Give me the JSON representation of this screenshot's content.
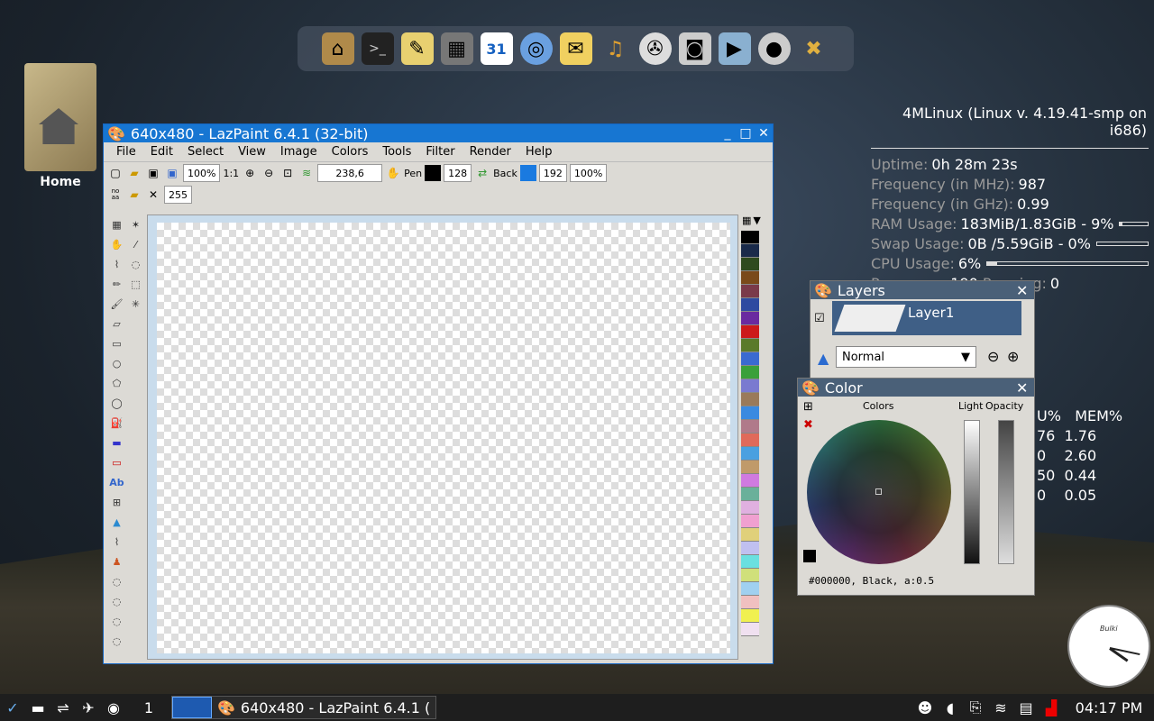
{
  "dock": {
    "icons": [
      "home-icon",
      "terminal-icon",
      "notes-icon",
      "calculator-icon",
      "calendar-icon",
      "browser-icon",
      "mail-icon",
      "headphones-icon",
      "video-reel-icon",
      "camera-icon",
      "camcorder-icon",
      "webcam-icon",
      "tools-icon"
    ],
    "calendar_day": "31"
  },
  "desktop": {
    "home_label": "Home"
  },
  "conky": {
    "title": "4MLinux (Linux v. 4.19.41-smp on i686)",
    "uptime_label": "Uptime:",
    "uptime": "0h 28m 23s",
    "freq_mhz_label": "Frequency (in MHz):",
    "freq_mhz": "987",
    "freq_ghz_label": "Frequency (in GHz):",
    "freq_ghz": "0.99",
    "ram_label": "RAM Usage:",
    "ram": "183MiB/1.83GiB - 9%",
    "ram_pct": 9,
    "swap_label": "Swap Usage:",
    "swap": "0B  /5.59GiB - 0%",
    "swap_pct": 0,
    "cpu_label": "CPU Usage:",
    "cpu": "6%",
    "cpu_pct": 6,
    "procs_label": "Processes:",
    "procs": "190",
    "running_label": "Running:",
    "running": "0",
    "proc_headers": [
      "U%",
      "MEM%"
    ],
    "proc_rows": [
      [
        "76",
        "1.76"
      ],
      [
        "0",
        "2.60"
      ],
      [
        "50",
        "0.44"
      ],
      [
        "0",
        "0.05"
      ]
    ]
  },
  "window": {
    "title": "640x480 - LazPaint 6.4.1 (32-bit)",
    "menu": [
      "File",
      "Edit",
      "Select",
      "View",
      "Image",
      "Colors",
      "Tools",
      "Filter",
      "Render",
      "Help"
    ],
    "zoom": "100%",
    "ratio": "1:1",
    "coords": "238,6",
    "pen_label": "Pen",
    "pen_alpha": "128",
    "back_label": "Back",
    "back_alpha": "192",
    "opacity": "100%",
    "tolerance": "255",
    "noaa": "no\naa"
  },
  "palette": [
    "#000000",
    "#1a2a4a",
    "#2e4a1e",
    "#7a4a1a",
    "#7a3a4a",
    "#2e4aa0",
    "#6a2aa0",
    "#cc1a1a",
    "#5a7a2a",
    "#3a6ad0",
    "#3aa03a",
    "#7a7ad0",
    "#9a7a5a",
    "#3a8ae0",
    "#b07a8a",
    "#e06a5a",
    "#4aa0e0",
    "#c09a6a",
    "#d07ae0",
    "#6ab09a",
    "#e0b0e0",
    "#f0a0d0",
    "#e0d07a",
    "#c0c0f0",
    "#6ae0e0",
    "#d0e07a",
    "#a0d0f0",
    "#f0c0c0",
    "#f0f050",
    "#f0e0f0"
  ],
  "layers": {
    "title": "Layers",
    "layer_name": "Layer1",
    "blend": "Normal"
  },
  "color": {
    "title": "Color",
    "colors_label": "Colors",
    "light_label": "Light",
    "opacity_label": "Opacity",
    "status": "#000000, Black, a:0.5"
  },
  "taskbar": {
    "workspace": "1",
    "task_title": "640x480 - LazPaint 6.4.1 (",
    "time": "04:17 PM"
  },
  "clock": {
    "label": "Bulki"
  }
}
